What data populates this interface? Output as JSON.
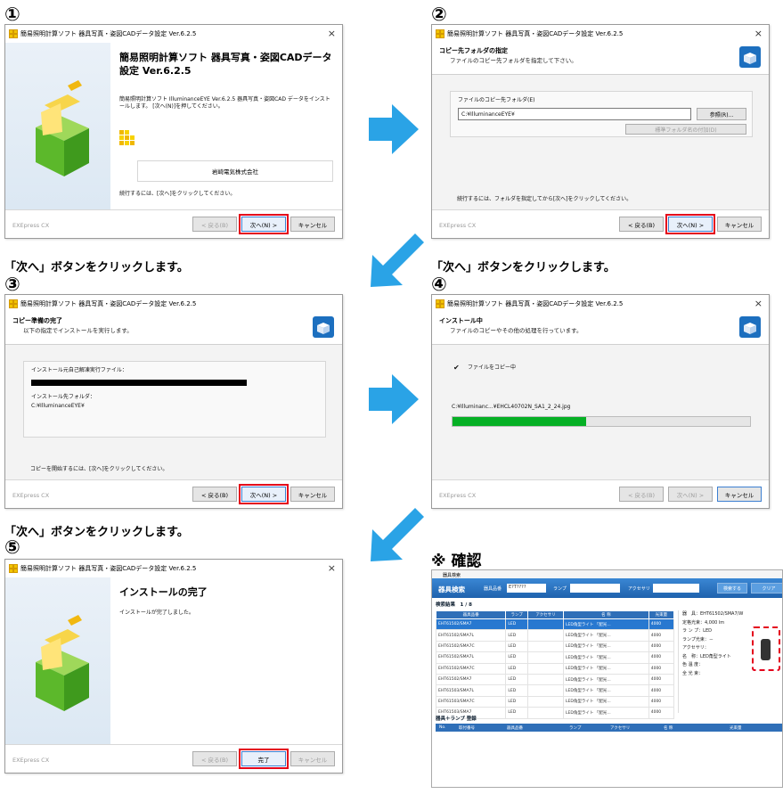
{
  "steps": {
    "s1": "①",
    "s2": "②",
    "s3": "③",
    "s4": "④",
    "s5": "⑤"
  },
  "dialog_title": "簡易照明計算ソフト 器具写真・姿図CADデータ設定 Ver.6.2.5",
  "close_glyph": "×",
  "brand": "EXEpress CX",
  "buttons": {
    "back": "< 戻る(B)",
    "next": "次へ(N) >",
    "cancel": "キャンセル",
    "finish": "完了"
  },
  "welcome": {
    "heading": "簡易照明計算ソフト 器具写真・姿図CADデータ設定 Ver.6.2.5",
    "desc": "簡易照明計算ソフト IlluminanceEYE Ver.6.2.5 器具写真・姿図CAD データをインストールします。 [次へ(N)]を押してください。",
    "company": "岩崎電気株式会社",
    "continue": "続行するには、[次へ]をクリックしてください。"
  },
  "copy_folder": {
    "h1": "コピー先フォルダの指定",
    "h2": "ファイルのコピー先フォルダを指定して下さい。",
    "group_label": "ファイルのコピー先フォルダ(E)",
    "path": "C:¥IlluminanceEYE¥",
    "browse": "参照(R)...",
    "std_button": "標準フォルダ名の付加(D)",
    "continue": "続行するには、フォルダを指定してから[次へ]をクリックしてください。"
  },
  "ready": {
    "h1": "コピー準備の完了",
    "h2": "以下の指定でインストールを実行します。",
    "src_label": "インストール元自己解凍実行ファイル：",
    "dst_label": "インストール先フォルダ：",
    "dst_value": "C:¥IlluminanceEYE¥",
    "continue": "コピーを開始するには、[次へ]をクリックしてください。"
  },
  "installing": {
    "h1": "インストール中",
    "h2": "ファイルのコピーやその他の処理を行っています。",
    "check": "✔",
    "status": "ファイルをコピー中",
    "file": "C:¥Illuminanc...¥EHCL40702N_SA1_2_24.jpg",
    "progress": 0.45
  },
  "complete": {
    "heading": "インストールの完了",
    "message": "インストールが完了しました。"
  },
  "captions": {
    "c1": "「次へ」ボタンをクリックします。",
    "c2": "「次へ」ボタンをクリックします。",
    "c3": "「次へ」ボタンをクリックします。"
  },
  "note": "※ 確認",
  "search_window": {
    "titlebar": "器具検索",
    "title": "器具検索",
    "lbl_kigu": "器具品番",
    "val_kigu": "E?T????",
    "lbl_lamp": "ランプ",
    "lbl_acc": "アクセサリ",
    "btn_search": "検索する",
    "btn_clear": "クリア",
    "results": "検索結果　1 / 8",
    "columns": [
      "器具品番",
      "ランプ",
      "アクセサリ",
      "名 称",
      "光束量"
    ],
    "rows": [
      [
        "EHT61502/SMA7",
        "LED",
        "",
        "LED角型ライト 「配光…",
        "4000"
      ],
      [
        "EHT61502/SMA7L",
        "LED",
        "",
        "LED角型ライト 「配光…",
        "4000"
      ],
      [
        "EHT61502/SMA7C",
        "LED",
        "",
        "LED角型ライト 「配光…",
        "4000"
      ],
      [
        "EHT61502/SMA7L",
        "LED",
        "",
        "LED角型ライト 「配光…",
        "4000"
      ],
      [
        "EHT61502/SMA7C",
        "LED",
        "",
        "LED角型ライト 「配光…",
        "4000"
      ],
      [
        "EHT61502/SMA7",
        "LED",
        "",
        "LED角型ライト 「配光…",
        "4000"
      ],
      [
        "EHT61503/SMA7L",
        "LED",
        "",
        "LED角型ライト 「配光…",
        "4000"
      ],
      [
        "EHT61503/SMA7C",
        "LED",
        "",
        "LED角型ライト 「配光…",
        "4000"
      ],
      [
        "EHT61503/SMA7",
        "LED",
        "",
        "LED角型ライト 「配光…",
        "4000"
      ]
    ],
    "detail": [
      "器　具：EHT61502/SMA7/W",
      "定格光束：4,000 lm",
      "ラ ン プ：LED",
      "ランプ光束：－",
      "アクセサリ：",
      "名　称：LED角型ライト",
      "色 温 度：",
      "全 光 束："
    ],
    "set_title": "器具＋ランプ 登録",
    "set_cols": [
      "No.",
      "取付番号",
      "器具品番",
      "ランプ",
      "アクセサリ",
      "名 称",
      "光束量"
    ]
  },
  "colors": {
    "arrow": "#2aa3e6",
    "highlight": "#e4001b",
    "progress": "#06b025"
  },
  "icons": [
    "gold-grid-icon",
    "installer-box-icon",
    "arrow-right-icon",
    "arrow-down-left-icon",
    "close-icon",
    "checkmark-icon"
  ]
}
